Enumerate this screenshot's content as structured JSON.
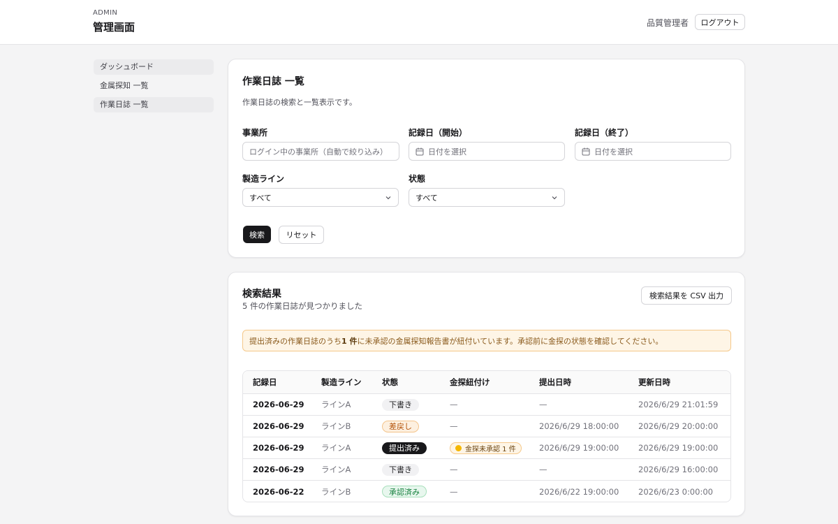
{
  "header": {
    "brand_sub": "ADMIN",
    "brand_title": "管理画面",
    "user_role": "品質管理者",
    "logout_label": "ログアウト"
  },
  "sidebar": {
    "items": [
      {
        "label": "ダッシュボード"
      },
      {
        "label": "金属探知 一覧"
      },
      {
        "label": "作業日誌 一覧"
      }
    ]
  },
  "search": {
    "title": "作業日誌 一覧",
    "description": "作業日誌の検索と一覧表示です。",
    "office_label": "事業所",
    "office_placeholder": "ログイン中の事業所（自動で絞り込み）",
    "start_label": "記録日（開始）",
    "start_placeholder": "日付を選択",
    "end_label": "記録日（終了）",
    "end_placeholder": "日付を選択",
    "line_label": "製造ライン",
    "line_value": "すべて",
    "status_label": "状態",
    "status_value": "すべて",
    "search_button": "検索",
    "reset_button": "リセット"
  },
  "results": {
    "title": "検索結果",
    "count_text": "5 件の作業日誌が見つかりました",
    "csv_button": "検索結果を CSV 出力",
    "alert_prefix": "提出済みの作業日誌のうち ",
    "alert_count": "1 件",
    "alert_suffix": "に未承認の金属探知報告書が紐付いています。承認前に金探の状態を確認してください。",
    "columns": {
      "date": "記録日",
      "line": "製造ライン",
      "status": "状態",
      "metal": "金探紐付け",
      "submitted": "提出日時",
      "updated": "更新日時"
    },
    "rows": [
      {
        "date": "2026-06-29",
        "line": "ラインA",
        "status": "下書き",
        "metal": "—",
        "submitted": "—",
        "updated": "2026/6/29 21:01:59"
      },
      {
        "date": "2026-06-29",
        "line": "ラインB",
        "status": "差戻し",
        "metal": "—",
        "submitted": "2026/6/29 18:00:00",
        "updated": "2026/6/29 20:00:00"
      },
      {
        "date": "2026-06-29",
        "line": "ラインA",
        "status": "提出済み",
        "metal": "金探未承認 1 件",
        "submitted": "2026/6/29 19:00:00",
        "updated": "2026/6/29 19:00:00"
      },
      {
        "date": "2026-06-29",
        "line": "ラインA",
        "status": "下書き",
        "metal": "—",
        "submitted": "—",
        "updated": "2026/6/29 16:00:00"
      },
      {
        "date": "2026-06-22",
        "line": "ラインB",
        "status": "承認済み",
        "metal": "—",
        "submitted": "2026/6/22 19:00:00",
        "updated": "2026/6/23 0:00:00"
      }
    ]
  },
  "colors": {
    "primary": "#18181b",
    "warning_bg": "#fef5e6",
    "warning_border": "#f5c88a",
    "approved": "#15803d",
    "returned": "#b45309"
  }
}
